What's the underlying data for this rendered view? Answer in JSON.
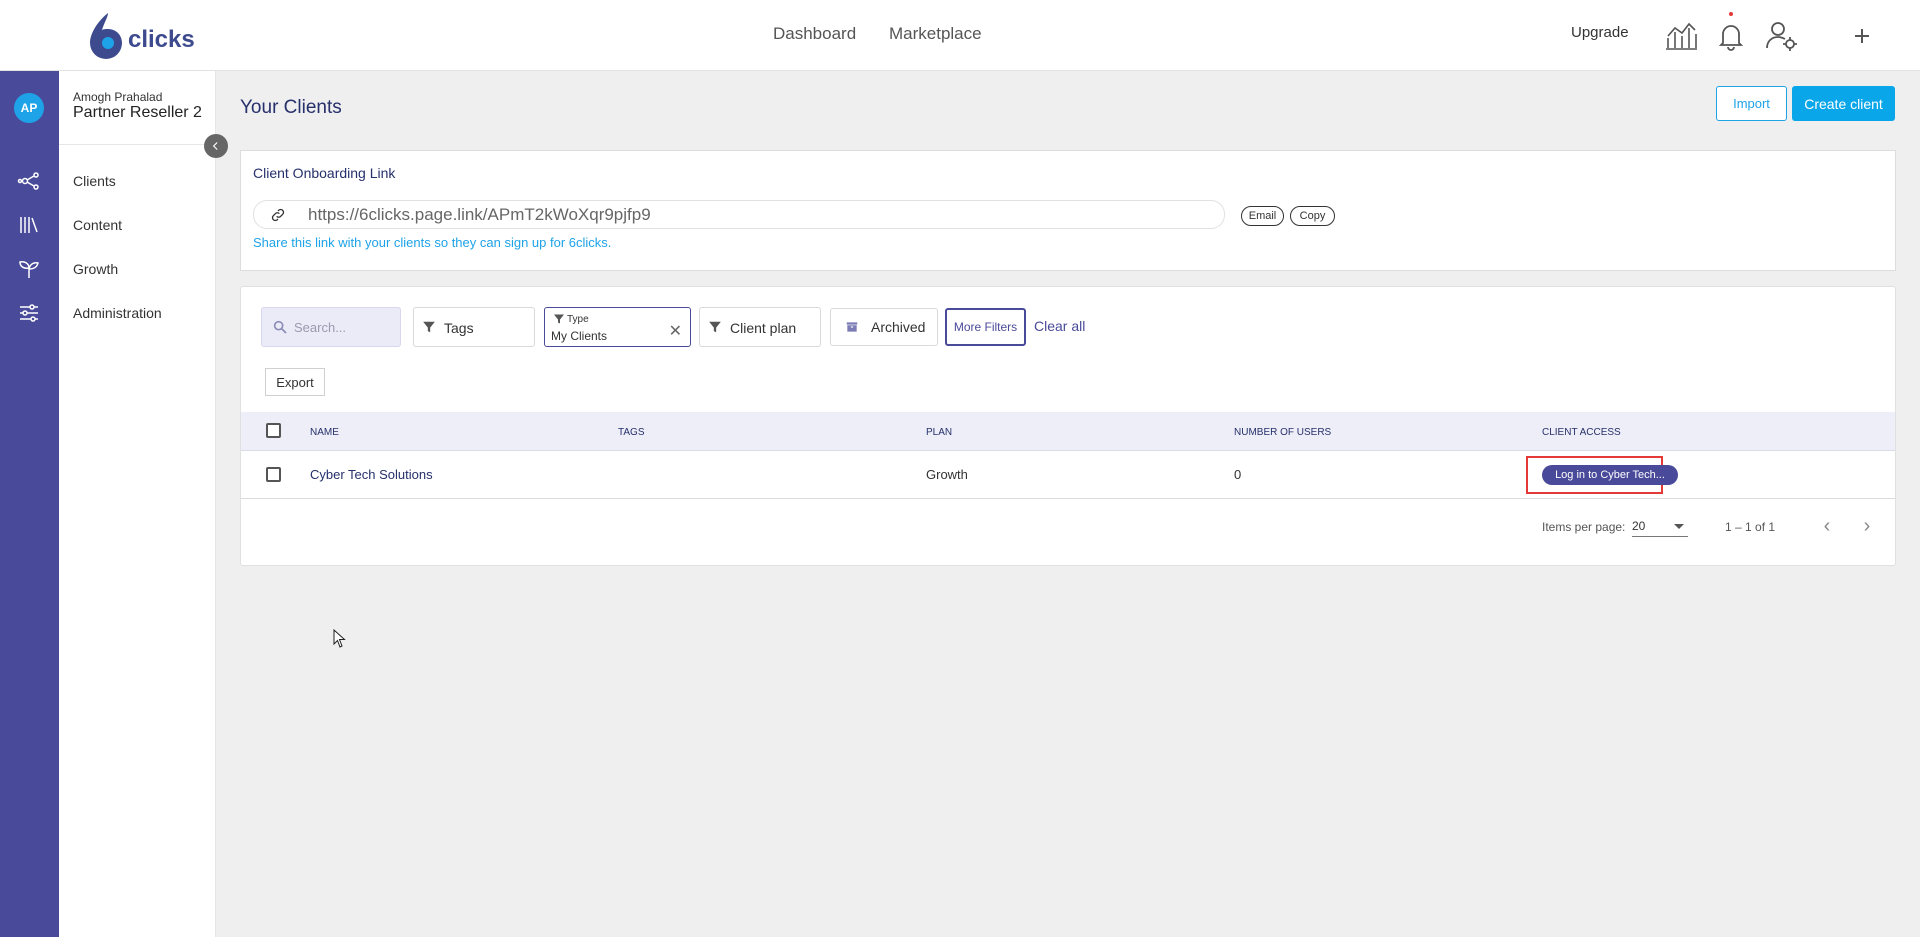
{
  "header": {
    "logo_text": "clicks",
    "nav": [
      "Dashboard",
      "Marketplace"
    ],
    "upgrade_label": "Upgrade",
    "icons": [
      "analytics-icon",
      "bell-icon",
      "user-settings-icon",
      "plus-icon"
    ]
  },
  "rail": {
    "avatar_initials": "AP",
    "icons": [
      "network-icon",
      "library-icon",
      "sprout-icon",
      "sliders-icon"
    ]
  },
  "sidebar": {
    "user_name": "Amogh Prahalad",
    "org_name": "Partner Reseller 2",
    "items": [
      {
        "label": "Clients"
      },
      {
        "label": "Content"
      },
      {
        "label": "Growth"
      },
      {
        "label": "Administration"
      }
    ]
  },
  "page": {
    "title": "Your Clients",
    "import_label": "Import",
    "create_label": "Create client"
  },
  "onboarding": {
    "title": "Client Onboarding Link",
    "url": "https://6clicks.page.link/APmT2kWoXqr9pjfp9",
    "email_label": "Email",
    "copy_label": "Copy",
    "hint": "Share this link with your clients so they can sign up for 6clicks."
  },
  "filters": {
    "search_placeholder": "Search...",
    "tags_label": "Tags",
    "type_label": "Type",
    "type_value": "My Clients",
    "plan_label": "Client plan",
    "archived_label": "Archived",
    "more_filters_label": "More Filters",
    "clear_all_label": "Clear all",
    "export_label": "Export"
  },
  "table": {
    "columns": [
      "NAME",
      "TAGS",
      "PLAN",
      "NUMBER OF USERS",
      "CLIENT ACCESS"
    ],
    "rows": [
      {
        "name": "Cyber Tech Solutions",
        "tags": "",
        "plan": "Growth",
        "users": "0",
        "access_label": "Log in to Cyber Tech..."
      }
    ]
  },
  "pagination": {
    "items_per_page_label": "Items per page:",
    "items_per_page": "20",
    "range": "1 – 1 of 1"
  },
  "colors": {
    "brand_purple": "#4a4a9a",
    "accent_blue": "#0aa6ea",
    "highlight_red": "#e53935"
  }
}
